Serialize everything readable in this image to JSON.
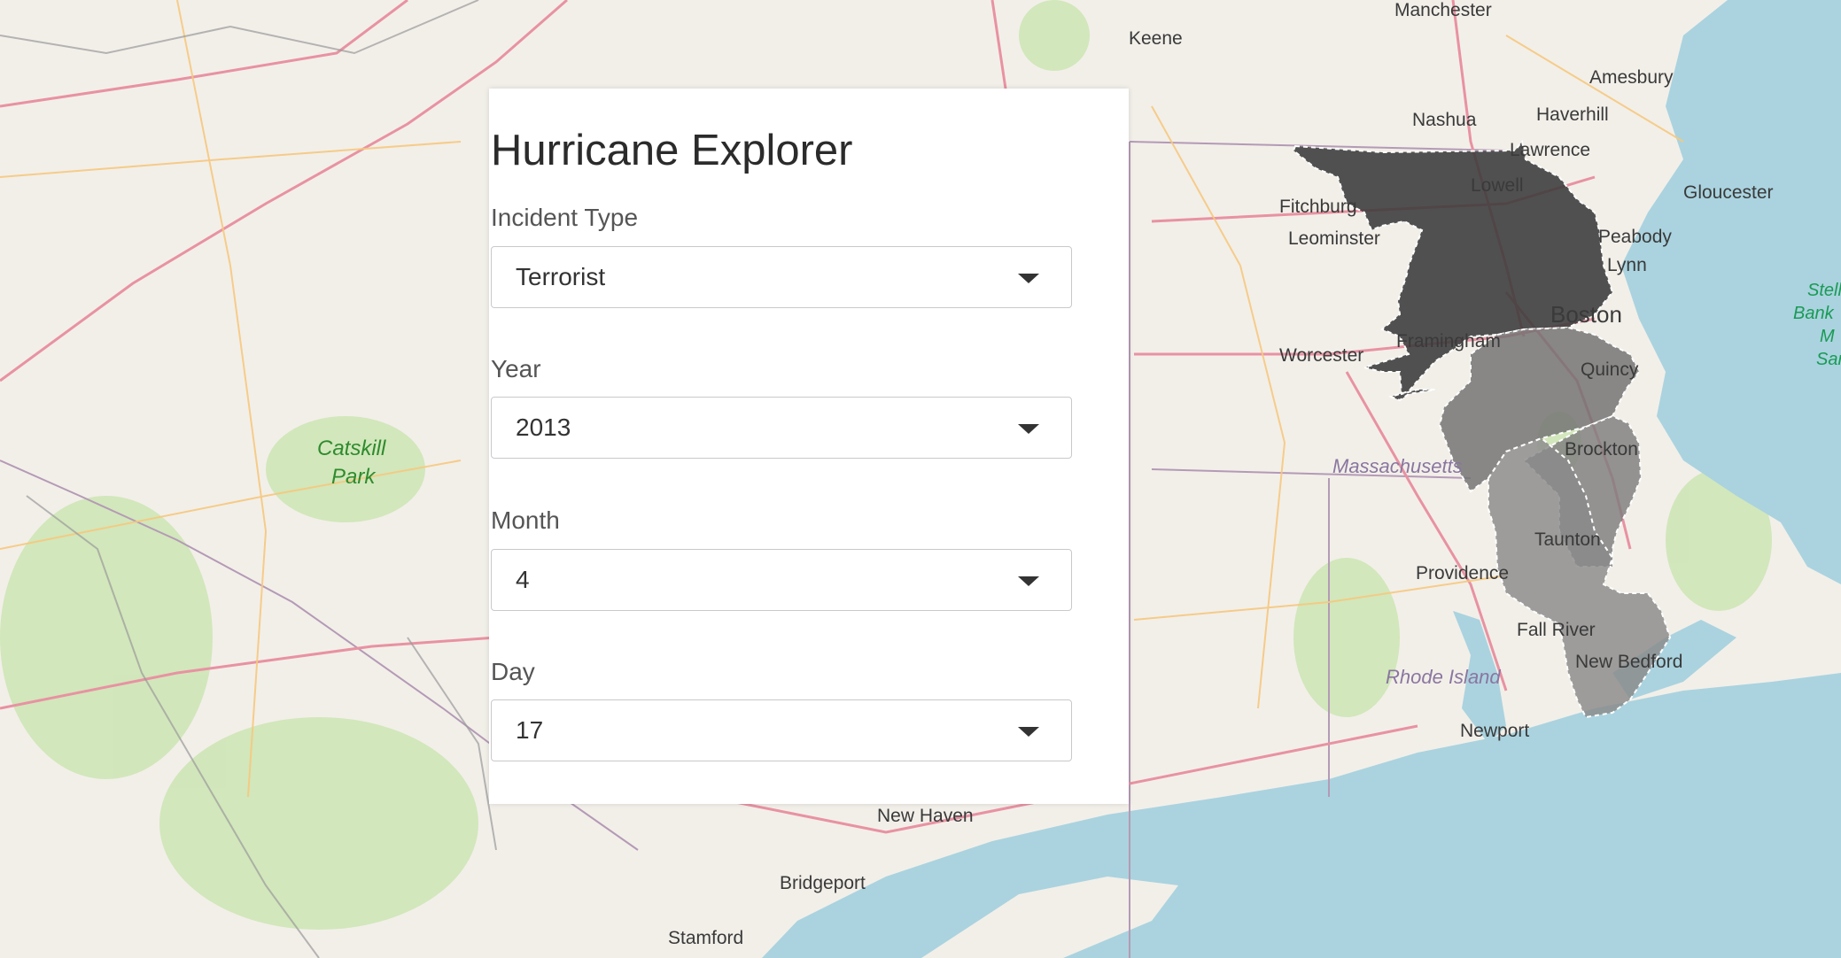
{
  "app": {
    "title": "Hurricane Explorer"
  },
  "filters": {
    "incident_type": {
      "label": "Incident Type",
      "value": "Terrorist"
    },
    "year": {
      "label": "Year",
      "value": "2013"
    },
    "month": {
      "label": "Month",
      "value": "4"
    },
    "day": {
      "label": "Day",
      "value": "17"
    }
  },
  "map": {
    "places": [
      "Manchester",
      "Keene",
      "Amesbury",
      "Nashua",
      "Haverhill",
      "Lawrence",
      "Gloucester",
      "Lowell",
      "Fitchburg",
      "Peabody",
      "Leominster",
      "Lynn",
      "Boston",
      "Framingham",
      "Worcester",
      "Quincy",
      "Brockton",
      "Taunton",
      "Providence",
      "Fall River",
      "New Bedford",
      "Newport",
      "New Haven",
      "Bridgeport",
      "Stamford"
    ],
    "park_label": [
      "Catskill",
      "Park"
    ],
    "state_labels": [
      "Massachusetts",
      "Rhode Island"
    ],
    "sanctuary_label": [
      "Stell",
      "Bank",
      "M",
      "San"
    ],
    "colors": {
      "land": "#f2efe9",
      "water": "#aad3df",
      "forest": "#cde5b3",
      "highlight_dark": "#3a3a3a",
      "highlight_mid": "#707070",
      "highlight_light": "#8a8a8a"
    }
  }
}
